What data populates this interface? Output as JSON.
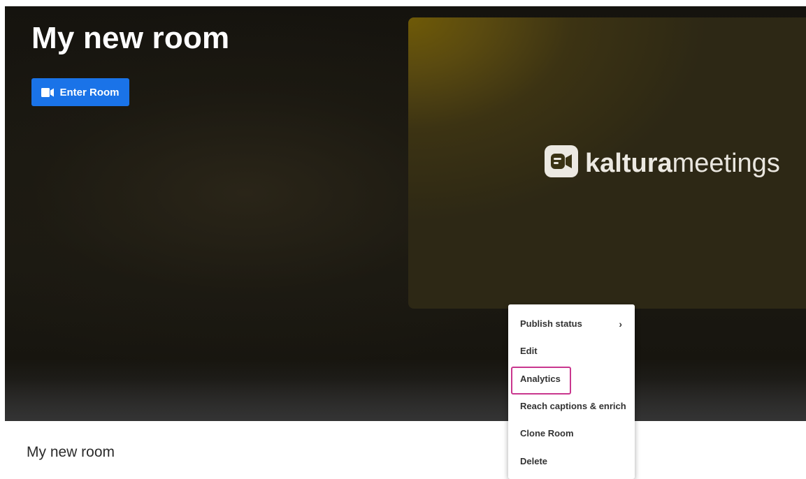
{
  "hero": {
    "title": "My new room",
    "enter_button_label": "Enter Room",
    "enter_button_icon": "video-camera-icon",
    "logo": {
      "brand_bold": "kaltura",
      "brand_light": "meetings",
      "icon": "kaltura-meetings-logo-icon"
    }
  },
  "content": {
    "section_title": "My new room"
  },
  "context_menu": {
    "items": [
      {
        "label": "Publish status",
        "has_submenu": true
      },
      {
        "label": "Edit"
      },
      {
        "label": "Analytics",
        "highlighted": true
      },
      {
        "label": "Reach captions & enrich"
      },
      {
        "label": "Clone Room"
      },
      {
        "label": "Delete"
      }
    ],
    "submenu_icon": "chevron-right-icon"
  },
  "colors": {
    "primary_button": "#1a73e8",
    "highlight_border": "#c9378e",
    "hero_background": "#17150f",
    "thumbnail_accent": "#6f5a07"
  }
}
